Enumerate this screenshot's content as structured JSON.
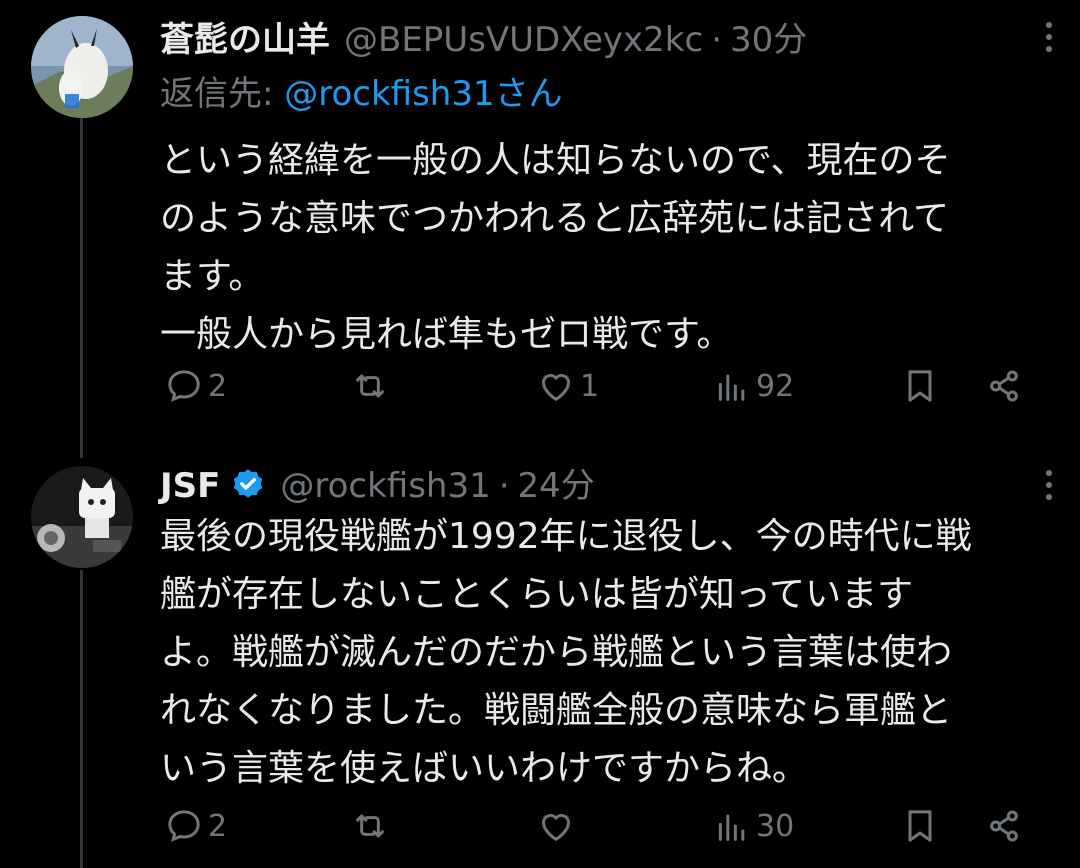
{
  "tweets": [
    {
      "name": "蒼髭の山羊",
      "handle": "@BEPUsVUDXeyx2kc",
      "separator": "·",
      "time": "30分",
      "reply_prefix": "返信先: ",
      "reply_mention": "@rockfish31さん",
      "body_lines": [
        "という経緯を一般の人は知らないので、現在のそ",
        "のような意味でつかわれると広辞苑には記されて",
        "ます。",
        "一般人から見れば隼もゼロ戦です。"
      ],
      "actions": {
        "replies": "2",
        "reposts": "",
        "likes": "1",
        "views": "92"
      },
      "avatar_icon": "mountain-goat-avatar"
    },
    {
      "name": "JSF",
      "verified": true,
      "handle": "@rockfish31",
      "separator": "·",
      "time": "24分",
      "body_lines": [
        "最後の現役戦艦が1992年に退役し、今の時代に戦",
        "艦が存在しないことくらいは皆が知っています",
        "よ。戦艦が滅んだのだから戦艦という言葉は使わ",
        "れなくなりました。戦闘艦全般の意味なら軍艦と",
        "いう言葉を使えばいいわけですからね。"
      ],
      "actions": {
        "replies": "2",
        "reposts": "",
        "likes": "",
        "views": "30"
      },
      "avatar_icon": "cat-figure-avatar"
    }
  ],
  "colors": {
    "background": "#000000",
    "text": "#e7e9ea",
    "muted": "#71767b",
    "link": "#1d9bf0",
    "verified": "#1d9bf0"
  }
}
